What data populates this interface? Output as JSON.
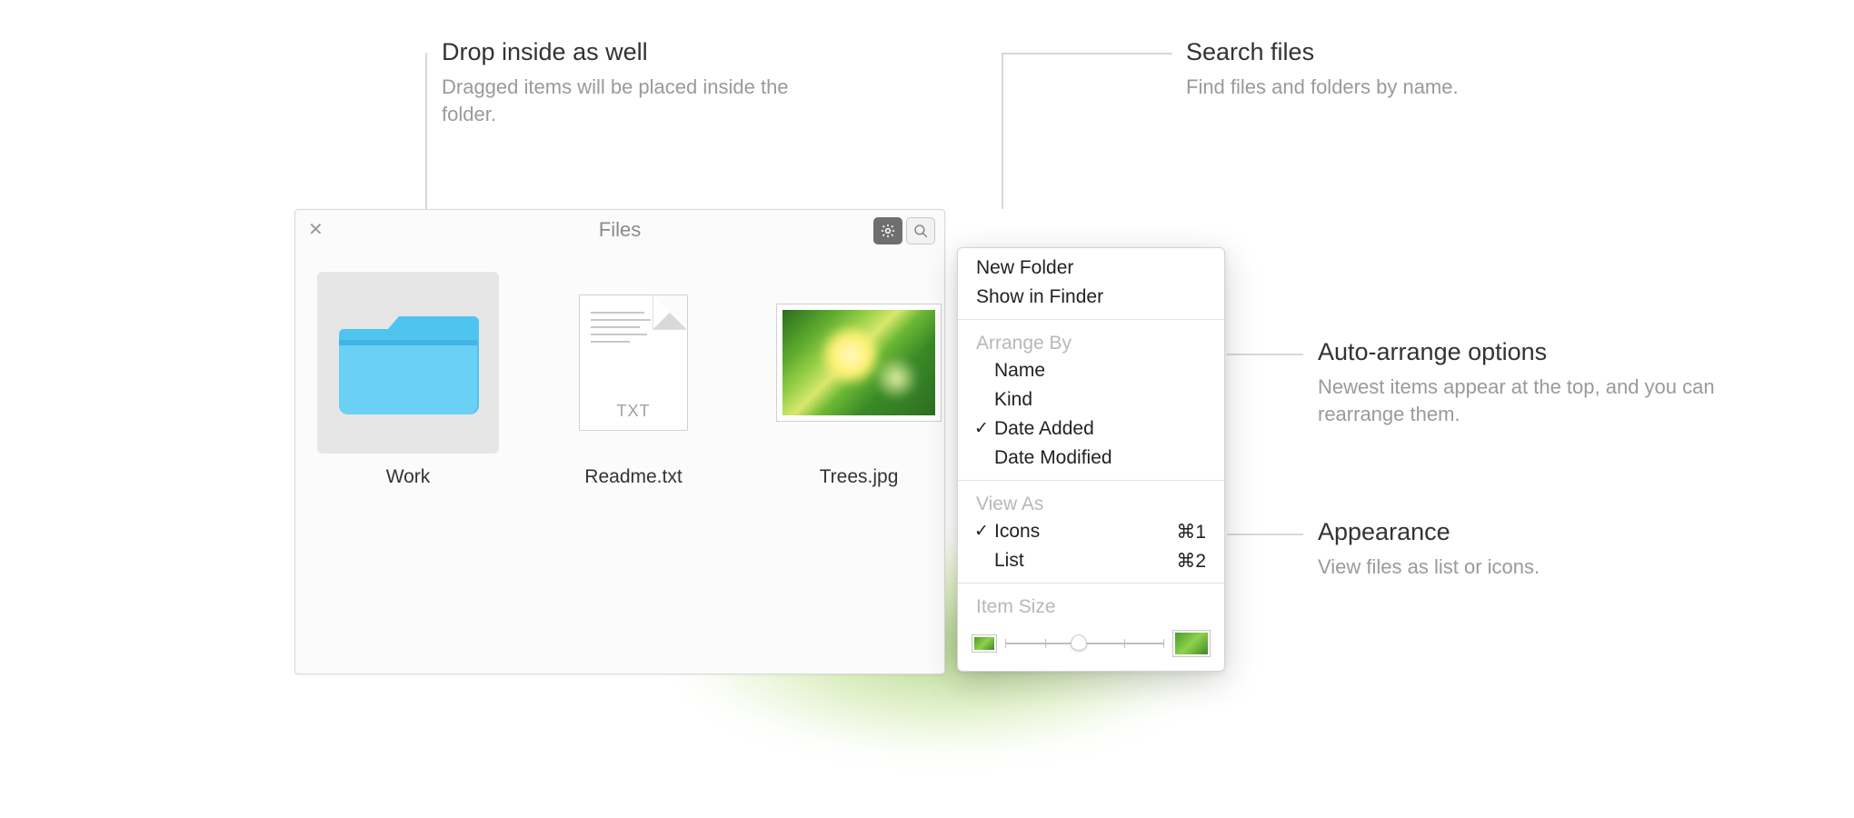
{
  "callouts": {
    "drop": {
      "title": "Drop inside as well",
      "desc": "Dragged items will be placed inside the folder."
    },
    "search": {
      "title": "Search files",
      "desc": "Find files and folders by name."
    },
    "arrange": {
      "title": "Auto-arrange options",
      "desc": "Newest items appear at the top, and you can rearrange them."
    },
    "appearance": {
      "title": "Appearance",
      "desc": "View files as list or icons."
    }
  },
  "window": {
    "title": "Files",
    "items": [
      {
        "label": "Work"
      },
      {
        "label": "Readme.txt"
      },
      {
        "label": "Trees.jpg"
      }
    ],
    "txt_ext": "TXT"
  },
  "menu": {
    "newFolder": "New Folder",
    "showInFinder": "Show in Finder",
    "arrangeBy": "Arrange By",
    "arrangeOptions": {
      "name": "Name",
      "kind": "Kind",
      "dateAdded": "Date Added",
      "dateModified": "Date Modified"
    },
    "viewAs": "View As",
    "viewOptions": {
      "icons": {
        "label": "Icons",
        "shortcut": "⌘1"
      },
      "list": {
        "label": "List",
        "shortcut": "⌘2"
      }
    },
    "itemSize": "Item Size",
    "check": "✓"
  }
}
